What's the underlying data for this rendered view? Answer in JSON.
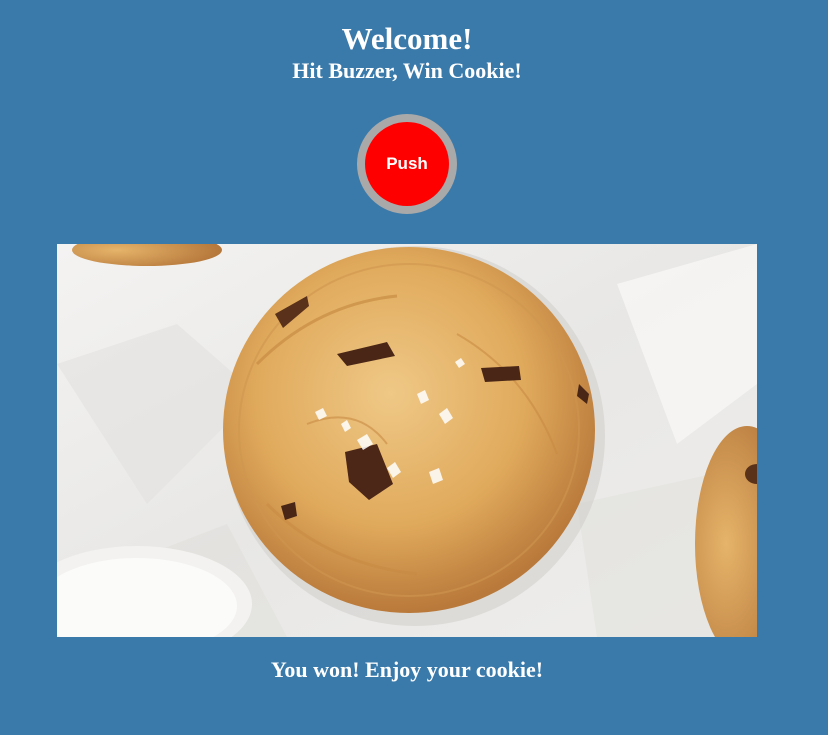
{
  "header": {
    "title": "Welcome!",
    "subtitle": "Hit Buzzer, Win Cookie!"
  },
  "buzzer": {
    "label": "Push",
    "color": "#ff0000",
    "ring_color": "#a9a9a9"
  },
  "result": {
    "message": "You won! Enjoy your cookie!"
  },
  "colors": {
    "background": "#3a7aab",
    "text": "#ffffff"
  }
}
